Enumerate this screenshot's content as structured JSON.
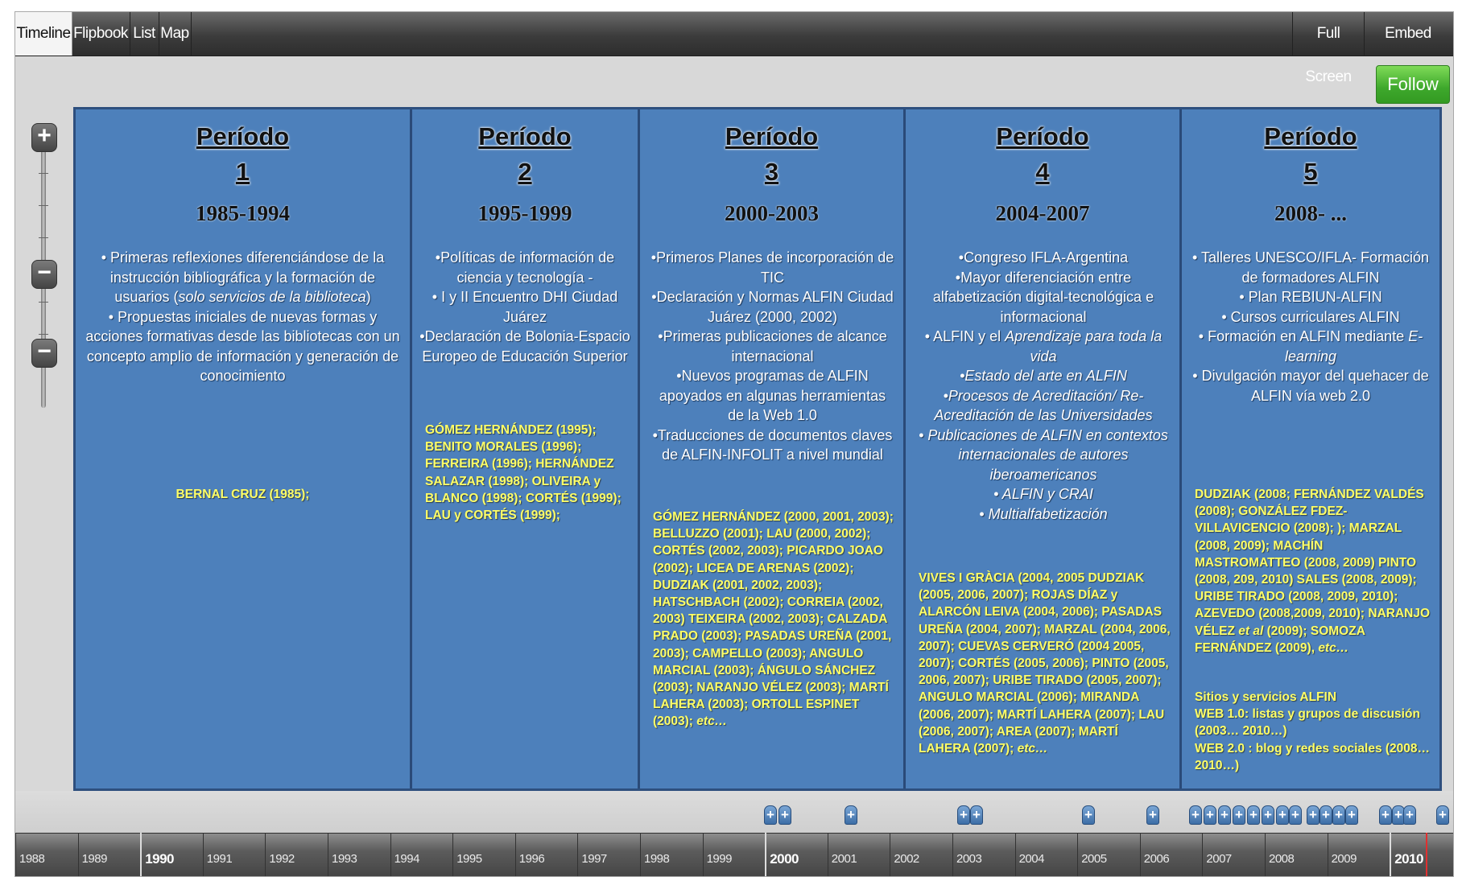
{
  "toolbar": {
    "tabs": [
      {
        "label": "Timeline"
      },
      {
        "label": "Flipbook"
      },
      {
        "label": "List"
      },
      {
        "label": "Map"
      }
    ],
    "full_screen": "Full Screen",
    "embed_widget": "Embed Widget",
    "follow": "Follow"
  },
  "zoom": {
    "plus": "+",
    "minus": "−"
  },
  "periods": [
    {
      "title_word": "Período",
      "number": "1",
      "years": "1985-1994",
      "refs": "BERNAL CRUZ (1985);"
    },
    {
      "title_word": "Período",
      "number": "2",
      "years": "1995-1999",
      "refs": "GÓMEZ HERNÁNDEZ (1995); BENITO MORALES (1996); FERREIRA (1996); HERNÁNDEZ SALAZAR (1998); OLIVEIRA y BLANCO (1998); CORTÉS (1999); LAU y CORTÉS (1999);"
    },
    {
      "title_word": "Período",
      "number": "3",
      "years": "2000-2003",
      "refs": "GÓMEZ HERNÁNDEZ (2000, 2001, 2003); BELLUZZO (2001); LAU (2000, 2002); CORTÉS (2002, 2003); PICARDO JOAO (2002); LICEA DE ARENAS (2002); DUDZIAK (2001, 2002, 2003); HATSCHBACH (2002); CORREIA (2002, 2003) TEIXEIRA (2002, 2003); CALZADA PRADO (2003); PASADAS UREÑA (2001, 2003); CAMPELLO (2003); ANGULO MARCIAL (2003); ÁNGULO SÁNCHEZ (2003); NARANJO VÉLEZ (2003); MARTÍ LAHERA (2003); ORTOLL ESPINET (2003);"
    },
    {
      "title_word": "Período",
      "number": "4",
      "years": "2004-2007",
      "refs": "VIVES I GRÀCIA (2004, 2005 DUDZIAK (2005, 2006, 2007); ROJAS DÍAZ y ALARCÓN LEIVA (2004, 2006); PASADAS UREÑA (2004, 2007); MARZAL (2004, 2006, 2007); CUEVAS CERVERÓ (2004 2005, 2007); CORTÉS (2005, 2006); PINTO (2005, 2006, 2007); URIBE TIRADO (2005, 2007); ANGULO MARCIAL (2006); MIRANDA (2006, 2007); MARTÍ LAHERA (2007); LAU (2006, 2007); AREA (2007); MARTÍ LAHERA (2007);"
    },
    {
      "title_word": "Período",
      "number": "5",
      "years": "2008- ...",
      "refs": "DUDZIAK (2008; FERNÁNDEZ VALDÉS (2008); GONZÁLEZ FDEZ-VILLAVICENCIO (2008); ); MARZAL (2008, 2009); MACHÍN MASTROMATTEO (2008, 2009) PINTO (2008, 209, 2010) SALES (2008, 2009); URIBE TIRADO (2008, 2009, 2010); AZEVEDO (2008,2009, 2010); NARANJO VÉLEZ",
      "refs_etal": "et al",
      "refs_tail": "(2009); SOMOZA FERNÁNDEZ (2009),",
      "sites": "Sitios y servicios ALFIN",
      "web10": "WEB 1.0: listas y grupos de discusión (2003… 2010…)",
      "web20": "WEB 2.0 : blog y redes sociales (2008… 2010…)"
    }
  ],
  "p1": {
    "l1": "• Primeras reflexiones diferenciándose de la instrucción bibliográfica y la formación de usuarios (",
    "l1i": "solo servicios de la biblioteca",
    "l1e": ")",
    "l2": "• Propuestas iniciales de nuevas formas y acciones formativas desde las bibliotecas con un concepto amplio de información y generación de conocimiento"
  },
  "p2": {
    "l1": "•Políticas de información de ciencia y tecnología -",
    "l2": "• I y II Encuentro DHI Ciudad Juárez",
    "l3": "•Declaración de Bolonia-Espacio Europeo de Educación Superior"
  },
  "p3": {
    "l1": "•Primeros Planes de incorporación de TIC",
    "l2": "•Declaración y Normas ALFIN Ciudad Juárez (2000, 2002)",
    "l3": "•Primeras publicaciones de alcance internacional",
    "l4": "•Nuevos programas de ALFIN apoyados en algunas herramientas de la Web 1.0",
    "l5": "•Traducciones de documentos claves de ALFIN-INFOLIT a nivel mundial"
  },
  "p4": {
    "l1": "•Congreso IFLA-Argentina",
    "l2": "•Mayor diferenciación entre alfabetización digital-tecnológica e informacional",
    "l3a": "• ALFIN y el ",
    "l3i": "Aprendizaje para toda la vida",
    "l4": "•Estado del arte en ALFIN",
    "l5": "•Procesos de Acreditación/ Re-Acreditación de las Universidades",
    "l6": "• Publicaciones de ALFIN en contextos internacionales de autores iberoamericanos",
    "l7": "• ALFIN y CRAI",
    "l8": "• Multialfabetización"
  },
  "p5": {
    "l1": "• Talleres UNESCO/IFLA- Formación de formadores ALFIN",
    "l2": "• Plan REBIUN-ALFIN",
    "l3": "• Cursos curriculares ALFIN",
    "l4a": "• Formación en ALFIN mediante ",
    "l4i": "E-learning",
    "l5": "• Divulgación mayor del quehacer de ALFIN vía web 2.0"
  },
  "etc": "etc…",
  "years": [
    "1988",
    "1989",
    "1990",
    "1991",
    "1992",
    "1993",
    "1994",
    "1995",
    "1996",
    "1997",
    "1998",
    "1999",
    "2000",
    "2001",
    "2002",
    "2003",
    "2004",
    "2005",
    "2006",
    "2007",
    "2008",
    "2009",
    "2010"
  ],
  "major_years": [
    "1990",
    "2000",
    "2010"
  ]
}
